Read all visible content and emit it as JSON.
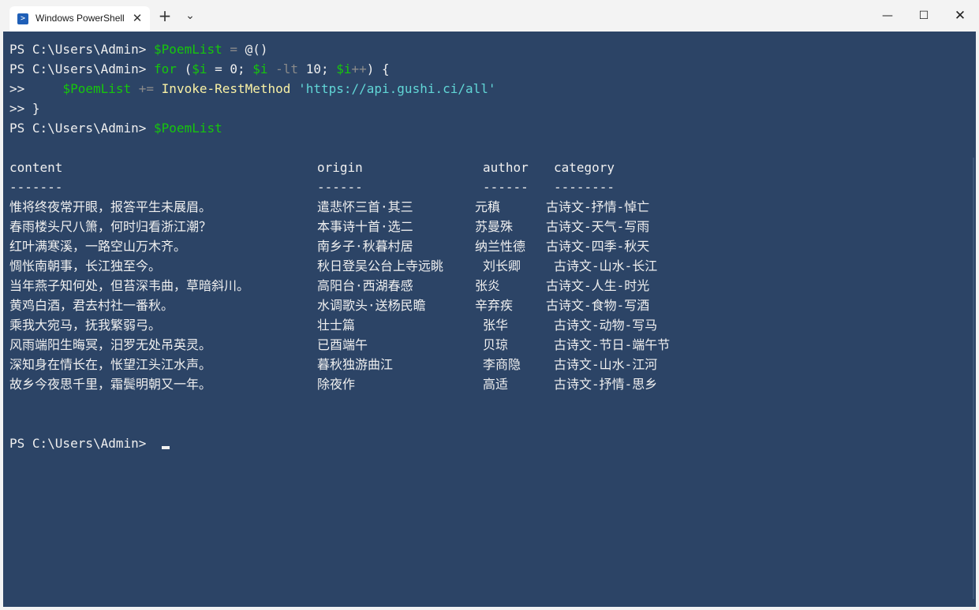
{
  "window": {
    "tab_title": "Windows PowerShell",
    "tab_close": "✕",
    "new_tab": "+",
    "dropdown": "⌄",
    "minimize": "—",
    "maximize": "☐",
    "close": "✕"
  },
  "prompt": "PS C:\\Users\\Admin> ",
  "continuation": ">> ",
  "commands": {
    "line1_var": "$PoemList",
    "line1_op": " = ",
    "line1_rest": "@()",
    "line2_kw": "for",
    "line2_a": " (",
    "line2_var1": "$i",
    "line2_b": " = 0; ",
    "line2_var2": "$i",
    "line2_op": " -lt",
    "line2_c": " 10; ",
    "line2_var3": "$i",
    "line2_op2": "++",
    "line2_d": ") {",
    "line3_indent": "    ",
    "line3_var": "$PoemList",
    "line3_op": " += ",
    "line3_cmd": "Invoke-RestMethod",
    "line3_str": " 'https://api.gushi.ci/all'",
    "line4": "}",
    "line5_var": "$PoemList"
  },
  "table": {
    "headers": [
      "content",
      "origin",
      "author",
      "category"
    ],
    "dashes": [
      "-------",
      "------",
      "------",
      "--------"
    ],
    "rows": [
      [
        "惟将终夜常开眼，报答平生未展眉。",
        "遣悲怀三首·其三",
        "元稹",
        "古诗文-抒情-悼亡"
      ],
      [
        "春雨楼头尺八箫，何时归看浙江潮？",
        "本事诗十首·选二",
        "苏曼殊",
        "古诗文-天气-写雨"
      ],
      [
        "红叶满寒溪，一路空山万木齐。",
        "南乡子·秋暮村居",
        "纳兰性德",
        "古诗文-四季-秋天"
      ],
      [
        "惆怅南朝事，长江独至今。",
        "秋日登吴公台上寺远眺",
        "刘长卿",
        "古诗文-山水-长江"
      ],
      [
        "当年燕子知何处，但苔深韦曲，草暗斜川。",
        "高阳台·西湖春感",
        "张炎",
        "古诗文-人生-时光"
      ],
      [
        "黄鸡白酒，君去村社一番秋。",
        "水调歌头·送杨民瞻",
        "辛弃疾",
        "古诗文-食物-写酒"
      ],
      [
        "乘我大宛马，抚我繁弱弓。",
        "壮士篇",
        "张华",
        "古诗文-动物-写马"
      ],
      [
        "风雨端阳生晦冥，汨罗无处吊英灵。",
        "已酉端午",
        "贝琼",
        "古诗文-节日-端午节"
      ],
      [
        "深知身在情长在，怅望江头江水声。",
        "暮秋独游曲江",
        "李商隐",
        "古诗文-山水-江河"
      ],
      [
        "故乡今夜思千里，霜鬓明朝又一年。",
        "除夜作",
        "高适",
        "古诗文-抒情-思乡"
      ]
    ]
  }
}
